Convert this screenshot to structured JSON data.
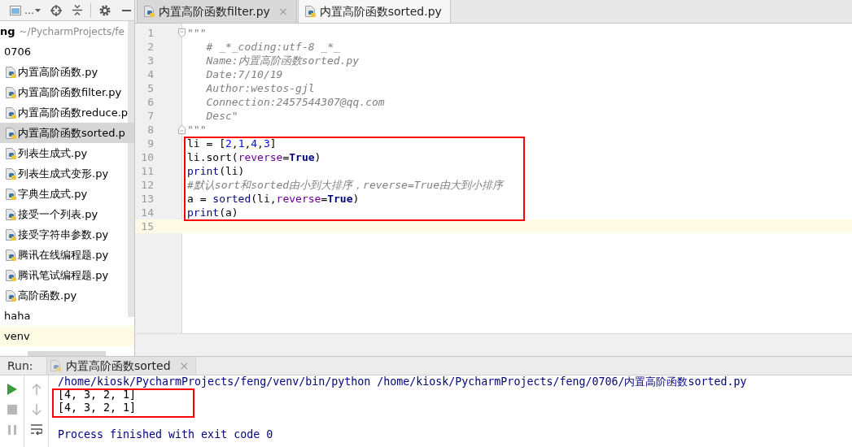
{
  "project_panel": {
    "view_label": "…",
    "tree": [
      {
        "kind": "project",
        "name": "ng",
        "path": "~/PycharmProjects/fe",
        "selected": false,
        "children": [
          {
            "kind": "folder",
            "name": "0706",
            "selected": false,
            "children": [
              {
                "kind": "python-file",
                "name": "内置高阶函数.py",
                "selected": false
              },
              {
                "kind": "python-file",
                "name": "内置高阶函数filter.py",
                "selected": false
              },
              {
                "kind": "python-file",
                "name": "内置高阶函数reduce.p",
                "selected": false
              },
              {
                "kind": "python-file",
                "name": "内置高阶函数sorted.p",
                "selected": true
              },
              {
                "kind": "python-file",
                "name": "列表生成式.py",
                "selected": false
              },
              {
                "kind": "python-file",
                "name": "列表生成式变形.py",
                "selected": false
              },
              {
                "kind": "python-file",
                "name": "字典生成式.py",
                "selected": false
              },
              {
                "kind": "python-file",
                "name": "接受一个列表.py",
                "selected": false
              },
              {
                "kind": "python-file",
                "name": "接受字符串参数.py",
                "selected": false
              },
              {
                "kind": "python-file",
                "name": "腾讯在线编程题.py",
                "selected": false
              },
              {
                "kind": "python-file",
                "name": "腾讯笔试编程题.py",
                "selected": false
              },
              {
                "kind": "python-file",
                "name": "高阶函数.py",
                "selected": false
              }
            ]
          },
          {
            "kind": "folder",
            "name": "haha",
            "selected": false
          },
          {
            "kind": "excluded-folder",
            "name": "venv",
            "selected": false
          }
        ]
      }
    ]
  },
  "editor": {
    "tabs": [
      {
        "label": "内置高阶函数filter.py",
        "selected": false,
        "close": "×"
      },
      {
        "label": "内置高阶函数sorted.py",
        "selected": true
      }
    ],
    "lines": [
      {
        "number": "1",
        "kind": "fold-start",
        "current": false,
        "boxed": false,
        "tokens": [
          {
            "kind": "docstring",
            "text": "\"\"\""
          }
        ]
      },
      {
        "number": "2",
        "kind": "code",
        "current": false,
        "boxed": false,
        "tokens": [
          {
            "kind": "docstring",
            "text": "   # _*_coding:utf-8 _*_"
          }
        ]
      },
      {
        "number": "3",
        "kind": "code",
        "current": false,
        "boxed": false,
        "tokens": [
          {
            "kind": "docstring",
            "text": "   Name:内置高阶函数sorted.py"
          }
        ]
      },
      {
        "number": "4",
        "kind": "code",
        "current": false,
        "boxed": false,
        "tokens": [
          {
            "kind": "docstring",
            "text": "   Date:7/10/19"
          }
        ]
      },
      {
        "number": "5",
        "kind": "code",
        "current": false,
        "boxed": false,
        "tokens": [
          {
            "kind": "docstring",
            "text": "   Author:westos-gjl"
          }
        ]
      },
      {
        "number": "6",
        "kind": "code",
        "current": false,
        "boxed": false,
        "tokens": [
          {
            "kind": "docstring",
            "text": "   Connection:2457544307@qq.com"
          }
        ]
      },
      {
        "number": "7",
        "kind": "code",
        "current": false,
        "boxed": false,
        "tokens": [
          {
            "kind": "docstring",
            "text": "   Desc\""
          }
        ]
      },
      {
        "number": "8",
        "kind": "fold-end",
        "current": false,
        "boxed": false,
        "tokens": [
          {
            "kind": "docstring",
            "text": "\"\"\""
          }
        ]
      },
      {
        "number": "9",
        "kind": "code",
        "current": false,
        "boxed": true,
        "tokens": [
          {
            "kind": "plain",
            "text": "li = ["
          },
          {
            "kind": "number",
            "text": "2"
          },
          {
            "kind": "plain",
            "text": ","
          },
          {
            "kind": "number",
            "text": "1"
          },
          {
            "kind": "plain",
            "text": ","
          },
          {
            "kind": "number",
            "text": "4"
          },
          {
            "kind": "plain",
            "text": ","
          },
          {
            "kind": "number",
            "text": "3"
          },
          {
            "kind": "plain",
            "text": "]"
          }
        ]
      },
      {
        "number": "10",
        "kind": "code",
        "current": false,
        "boxed": true,
        "tokens": [
          {
            "kind": "plain",
            "text": "li.sort("
          },
          {
            "kind": "kwarg",
            "text": "reverse"
          },
          {
            "kind": "plain",
            "text": "="
          },
          {
            "kind": "keyword",
            "text": "True"
          },
          {
            "kind": "plain",
            "text": ")"
          }
        ]
      },
      {
        "number": "11",
        "kind": "code",
        "current": false,
        "boxed": true,
        "tokens": [
          {
            "kind": "builtin",
            "text": "print"
          },
          {
            "kind": "plain",
            "text": "(li)"
          }
        ]
      },
      {
        "number": "12",
        "kind": "code",
        "current": false,
        "boxed": true,
        "tokens": [
          {
            "kind": "comment",
            "text": "#默认sort和sorted由小到大排序，reverse=True由大到小排序"
          }
        ]
      },
      {
        "number": "13",
        "kind": "code",
        "current": false,
        "boxed": true,
        "tokens": [
          {
            "kind": "plain",
            "text": "a = "
          },
          {
            "kind": "builtin",
            "text": "sorted"
          },
          {
            "kind": "plain",
            "text": "(li,"
          },
          {
            "kind": "kwarg",
            "text": "reverse"
          },
          {
            "kind": "plain",
            "text": "="
          },
          {
            "kind": "keyword",
            "text": "True"
          },
          {
            "kind": "plain",
            "text": ")"
          }
        ]
      },
      {
        "number": "14",
        "kind": "code",
        "current": false,
        "boxed": true,
        "tokens": [
          {
            "kind": "builtin",
            "text": "print"
          },
          {
            "kind": "plain",
            "text": "(a)"
          }
        ]
      },
      {
        "number": "15",
        "kind": "code",
        "current": true,
        "boxed": false
      }
    ]
  },
  "run_panel": {
    "title": "Run:",
    "tab": {
      "label": "内置高阶函数sorted",
      "close": "×"
    },
    "toolbar_columns": [
      {
        "buttons": [
          {
            "kind": "run",
            "disabled": false
          },
          {
            "kind": "stop",
            "disabled": true
          },
          {
            "kind": "pause",
            "disabled": true
          }
        ]
      },
      {
        "buttons": [
          {
            "kind": "up",
            "disabled": true
          },
          {
            "kind": "down",
            "disabled": true
          },
          {
            "kind": "soft-wrap",
            "disabled": false
          }
        ]
      }
    ],
    "console": [
      {
        "kind": "command",
        "text": "/home/kiosk/PycharmProjects/feng/venv/bin/python /home/kiosk/PycharmProjects/feng/0706/内置高阶函数sorted.py",
        "boxed": false
      },
      {
        "kind": "output",
        "text": "[4, 3, 2, 1]",
        "boxed": true
      },
      {
        "kind": "output",
        "text": "[4, 3, 2, 1]",
        "boxed": true
      },
      {
        "kind": "exit",
        "text": "Process finished with exit code 0",
        "boxed": false
      }
    ]
  }
}
